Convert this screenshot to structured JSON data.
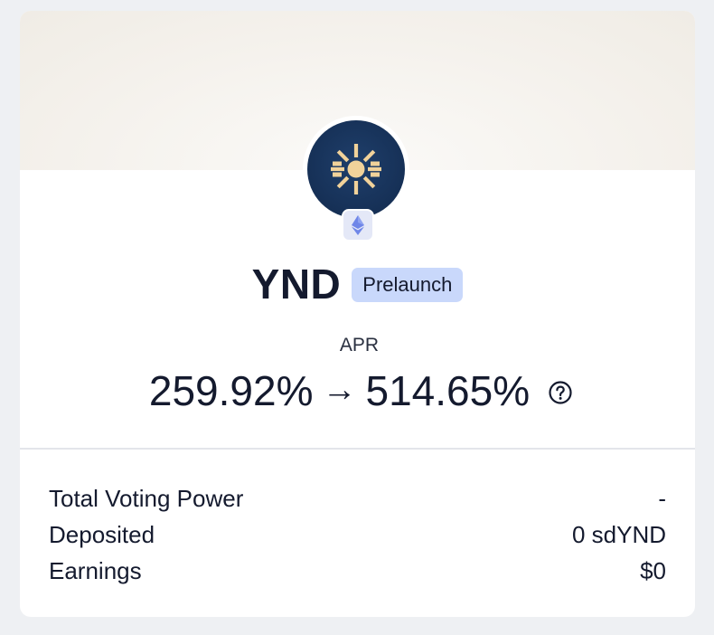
{
  "token": {
    "name": "YND",
    "status_tag": "Prelaunch",
    "logo_icon": "sun-burst-icon",
    "chain_icon": "ethereum-icon"
  },
  "apr": {
    "label": "APR",
    "current": "259.92%",
    "arrow": "→",
    "boosted": "514.65%",
    "help_icon": "question-circle-icon"
  },
  "stats": [
    {
      "label": "Total Voting Power",
      "value": "-"
    },
    {
      "label": "Deposited",
      "value": "0 sdYND"
    },
    {
      "label": "Earnings",
      "value": "$0"
    }
  ],
  "colors": {
    "page_bg": "#eef0f3",
    "card_bg": "#ffffff",
    "banner_bg": "#f3efe9",
    "logo_bg": "#173259",
    "logo_accent": "#f1d29a",
    "tag_bg": "#c9d8fb",
    "text": "#141a2e"
  }
}
